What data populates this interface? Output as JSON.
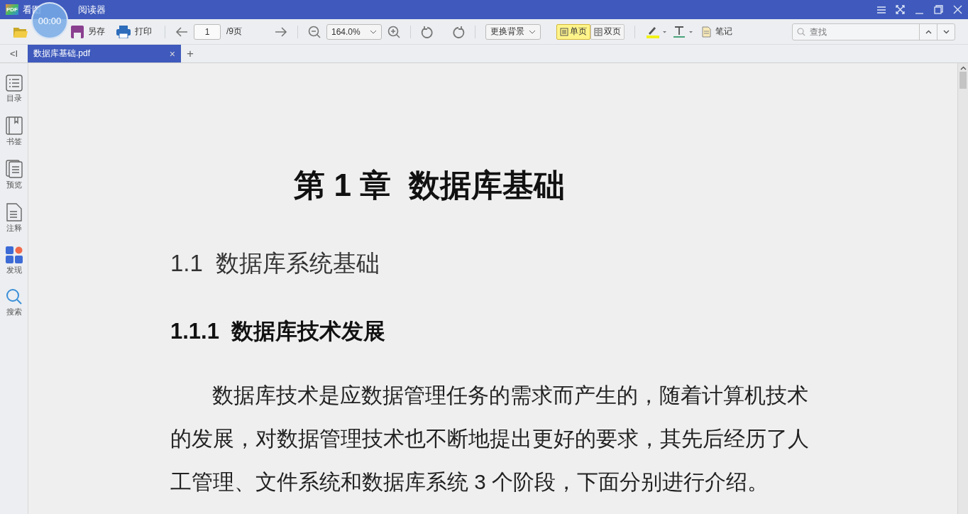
{
  "window": {
    "title_parts": [
      "看图",
      "阅读器"
    ],
    "logo": "PDF",
    "timer": "00:00"
  },
  "toolbar": {
    "save_as": "另存",
    "print": "打印",
    "page": "1",
    "page_total": "/9页",
    "zoom": "164.0%",
    "background": "更换背景",
    "view_modes": [
      {
        "label": "单页",
        "selected": true
      },
      {
        "label": "双页",
        "selected": false
      }
    ],
    "note": "笔记",
    "search": {
      "placeholder": "查找"
    }
  },
  "tabs": [
    {
      "label": "数据库基础.pdf",
      "selected": true,
      "close": "×"
    }
  ],
  "new_tab": "+",
  "collapse": "<I",
  "sidebar": {
    "items": [
      {
        "label": "目录",
        "kind": "list"
      },
      {
        "label": "书签",
        "kind": "bookmark"
      },
      {
        "label": "预览",
        "kind": "pages"
      },
      {
        "label": "注释",
        "kind": "note"
      },
      {
        "label": "发现",
        "kind": "apps"
      },
      {
        "label": "搜索",
        "kind": "search"
      }
    ]
  },
  "document": {
    "chapter": "第 1 章  数据库基础",
    "section": "1.1  数据库系统基础",
    "subsection": "1.1.1  数据库技术发展",
    "paragraph": "数据库技术是应数据管理任务的需求而产生的，随着计算机技术的发展，对数据管理技术也不断地提出更好的要求，其先后经历了人工管理、文件系统和数据库系统 3 个阶段，下面分别进行介绍。"
  }
}
